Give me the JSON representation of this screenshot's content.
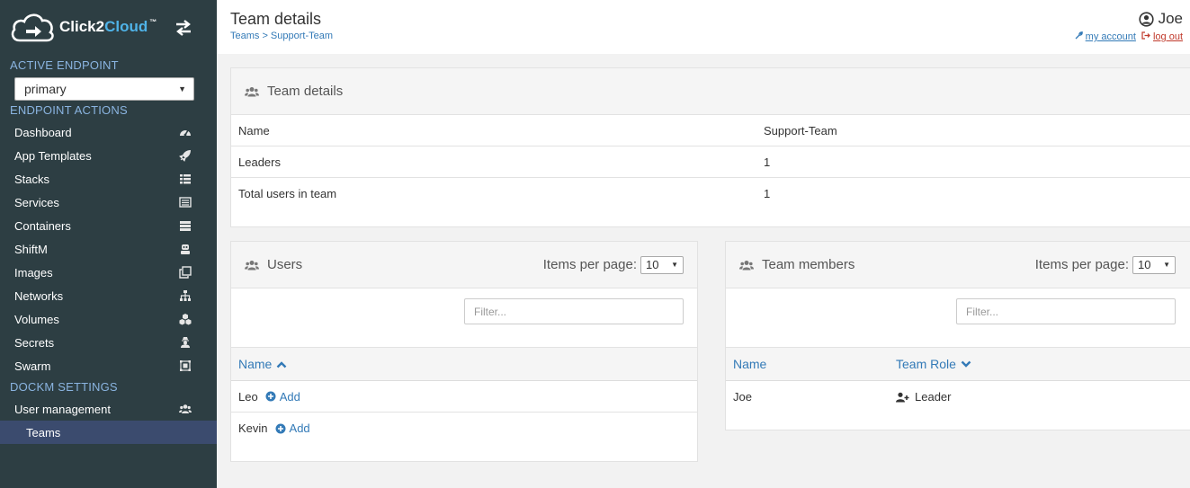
{
  "brand": {
    "name_part1": "Click2",
    "name_part2": "Cloud",
    "tm": "™"
  },
  "sidebar": {
    "active_endpoint_title": "ACTIVE ENDPOINT",
    "endpoint_value": "primary",
    "endpoint_actions_title": "ENDPOINT ACTIONS",
    "items": [
      {
        "label": "Dashboard",
        "icon": "dashboard-icon"
      },
      {
        "label": "App Templates",
        "icon": "rocket-icon"
      },
      {
        "label": "Stacks",
        "icon": "list-icon"
      },
      {
        "label": "Services",
        "icon": "services-icon"
      },
      {
        "label": "Containers",
        "icon": "server-icon"
      },
      {
        "label": "ShiftM",
        "icon": "robot-icon"
      },
      {
        "label": "Images",
        "icon": "clone-icon"
      },
      {
        "label": "Networks",
        "icon": "sitemap-icon"
      },
      {
        "label": "Volumes",
        "icon": "cubes-icon"
      },
      {
        "label": "Secrets",
        "icon": "user-secret-icon"
      },
      {
        "label": "Swarm",
        "icon": "object-group-icon"
      }
    ],
    "settings_title": "DOCKM SETTINGS",
    "user_management": {
      "label": "User management",
      "icon": "users-icon"
    },
    "teams": {
      "label": "Teams"
    }
  },
  "header": {
    "title": "Team details",
    "breadcrumb": "Teams > Support-Team",
    "username": "Joe",
    "my_account": "my account",
    "log_out": "log out"
  },
  "details": {
    "title": "Team details",
    "rows": [
      {
        "key": "Name",
        "value": "Support-Team"
      },
      {
        "key": "Leaders",
        "value": "1"
      },
      {
        "key": "Total users in team",
        "value": "1"
      }
    ]
  },
  "users": {
    "title": "Users",
    "items_per_page_label": "Items per page:",
    "items_per_page": "10",
    "filter_placeholder": "Filter...",
    "col_name": "Name",
    "add_label": "Add",
    "rows": [
      "Leo",
      "Kevin"
    ]
  },
  "members": {
    "title": "Team members",
    "items_per_page_label": "Items per page:",
    "items_per_page": "10",
    "filter_placeholder": "Filter...",
    "col_name": "Name",
    "col_role": "Team Role",
    "rows": [
      {
        "name": "Joe",
        "role": "Leader"
      }
    ]
  },
  "colors": {
    "sidebar_bg": "#2d3e43",
    "sidebar_active": "#3b4b6e",
    "section_title": "#8ab4e0",
    "link": "#337ab7",
    "logout": "#c0392b"
  }
}
